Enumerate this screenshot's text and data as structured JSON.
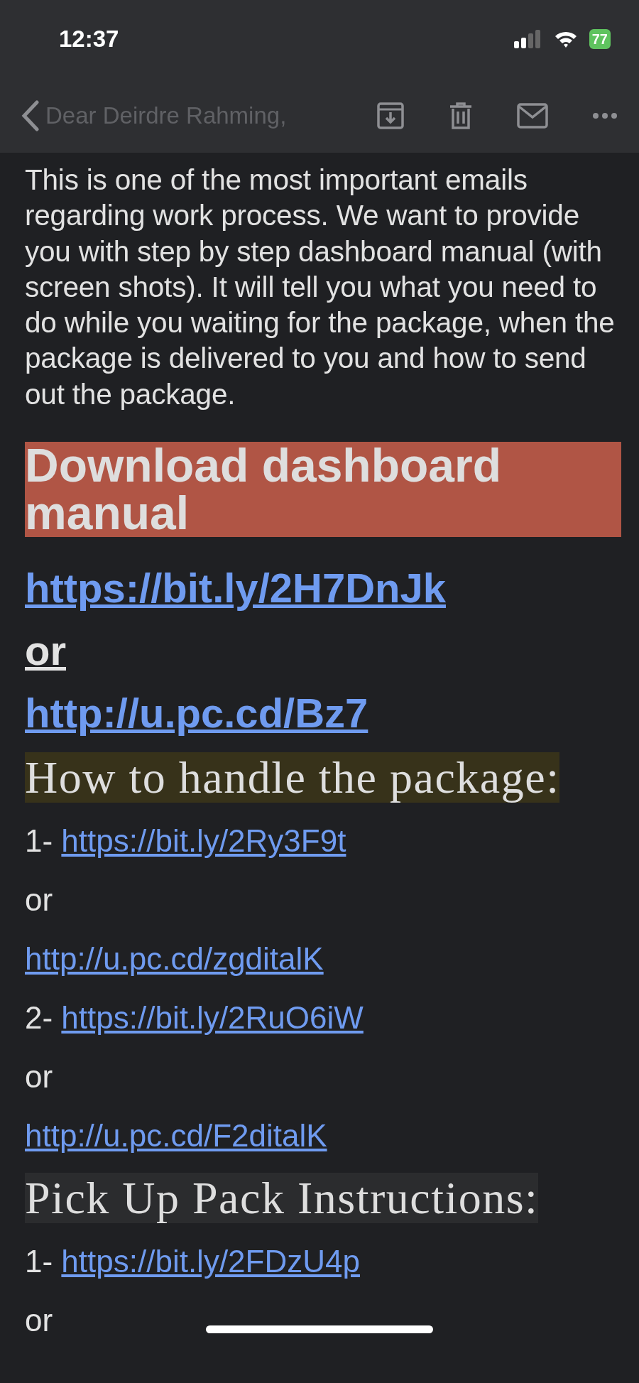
{
  "status_bar": {
    "time": "12:37",
    "battery": "77"
  },
  "toolbar": {
    "ghost_text": "Dear Deirdre Rahming,"
  },
  "body": [
    {
      "kind": "paragraph",
      "text": "This is one of the most important emails regarding work process. We want to provide you with step by step dashboard manual (with screen shots). It will tell you what you need to do while you waiting for the package, when the package is delivered to you and how to send out the package."
    },
    {
      "kind": "banner",
      "text": "Download dashboard manual",
      "color": "#b05545"
    },
    {
      "kind": "big_link",
      "link": "https://bit.ly/2H7DnJk"
    },
    {
      "kind": "big_text",
      "text": "or"
    },
    {
      "kind": "big_link",
      "link": "http://u.pc.cd/Bz7"
    },
    {
      "kind": "serif_heading",
      "text": "How to handle the package:",
      "color": "#37321a"
    },
    {
      "kind": "link_item",
      "prefix": "1-",
      "link": "https://bit.ly/2Ry3F9t"
    },
    {
      "kind": "text",
      "text": "or"
    },
    {
      "kind": "link_item",
      "link": "http://u.pc.cd/zgditalK"
    },
    {
      "kind": "link_item",
      "prefix": "2-",
      "link": "https://bit.ly/2RuO6iW"
    },
    {
      "kind": "text",
      "text": "or"
    },
    {
      "kind": "link_item",
      "link": "http://u.pc.cd/F2ditalK"
    },
    {
      "kind": "serif_heading",
      "text": "Pick Up Pack Instructions:",
      "color": "#2b2c2e"
    },
    {
      "kind": "link_item",
      "prefix": "1-",
      "link": "https://bit.ly/2FDzU4p"
    },
    {
      "kind": "text",
      "text": "or"
    }
  ]
}
